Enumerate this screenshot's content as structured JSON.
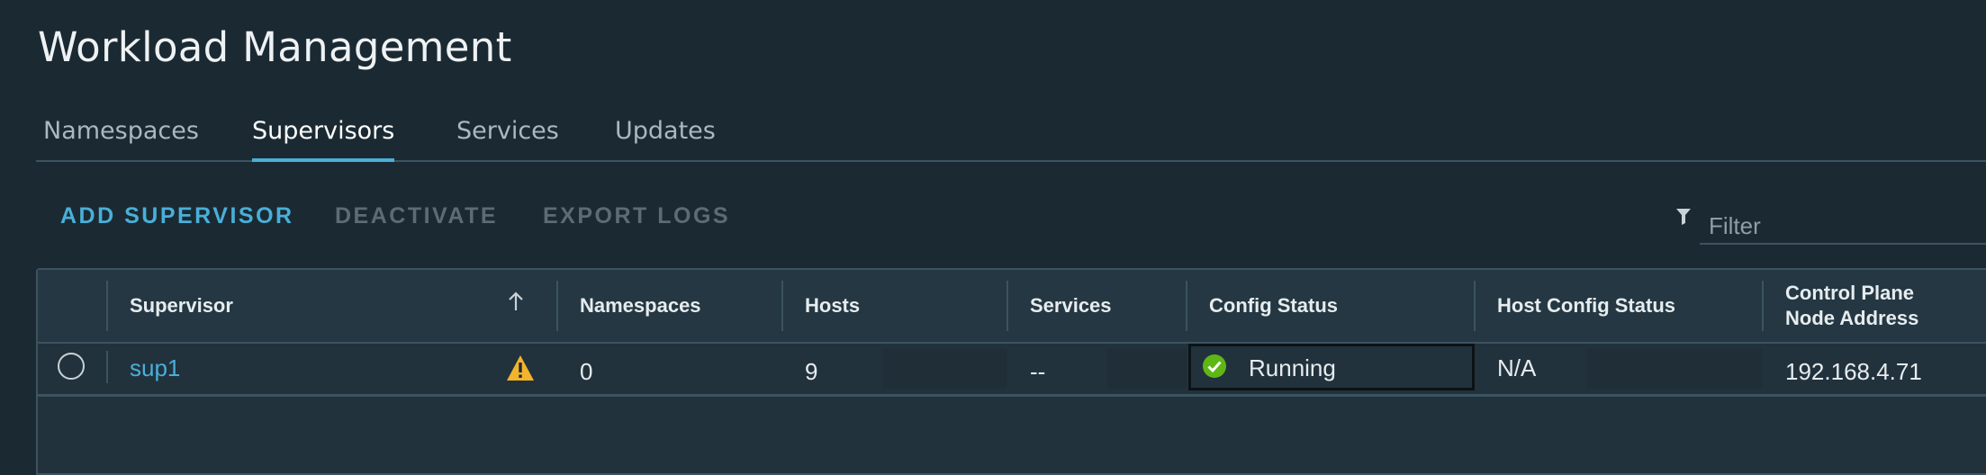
{
  "page": {
    "title": "Workload Management"
  },
  "tabs": [
    {
      "label": "Namespaces",
      "active": false
    },
    {
      "label": "Supervisors",
      "active": true
    },
    {
      "label": "Services",
      "active": false
    },
    {
      "label": "Updates",
      "active": false
    }
  ],
  "toolbar": {
    "add_label": "ADD SUPERVISOR",
    "deactivate_label": "DEACTIVATE",
    "export_label": "EXPORT LOGS"
  },
  "filter": {
    "placeholder": "Filter",
    "icon": "filter-icon"
  },
  "table": {
    "columns": {
      "supervisor": "Supervisor",
      "namespaces": "Namespaces",
      "hosts": "Hosts",
      "services": "Services",
      "config_status": "Config Status",
      "host_config_status": "Host Config Status",
      "control_plane_line1": "Control Plane",
      "control_plane_line2": "Node Address"
    },
    "sort_icon": "arrow-up-icon",
    "rows": [
      {
        "supervisor": "sup1",
        "warning_icon": "warning-icon",
        "namespaces": "0",
        "hosts": "9",
        "services": "--",
        "config_status": "Running",
        "config_status_icon": "check-circle-icon",
        "host_config_status": "N/A",
        "control_plane_address": "192.168.4.71"
      }
    ]
  },
  "colors": {
    "background": "#1b2a32",
    "accent": "#49afd9",
    "warning": "#f2b32d",
    "success": "#5eb715"
  }
}
